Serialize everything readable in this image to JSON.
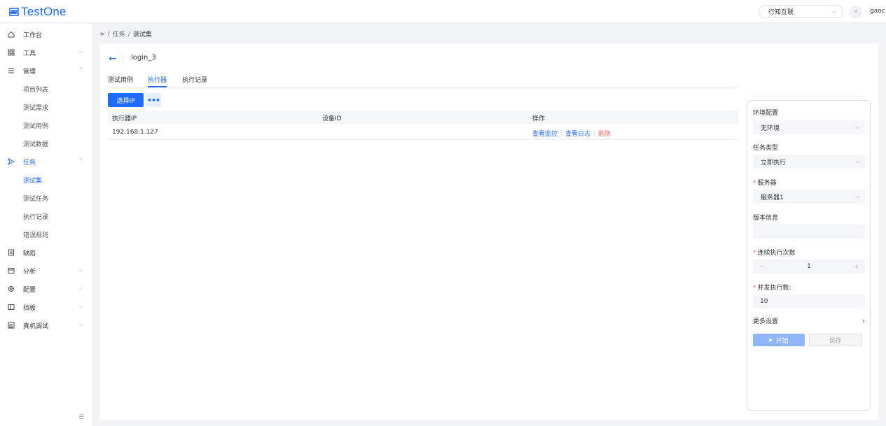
{
  "app": {
    "name": "TestOne"
  },
  "header": {
    "org": "行知互联",
    "lang_icon": "translate-icon",
    "user": "gaoc"
  },
  "sidebar": {
    "items": [
      {
        "label": "工作台",
        "icon": "home-icon"
      },
      {
        "label": "工具",
        "icon": "grid-icon"
      },
      {
        "label": "管理",
        "icon": "list-icon"
      },
      {
        "label": "项目列表"
      },
      {
        "label": "测试需求"
      },
      {
        "label": "测试用例"
      },
      {
        "label": "测试数据"
      },
      {
        "label": "任务",
        "icon": "send-icon"
      },
      {
        "label": "测试集"
      },
      {
        "label": "测试任务"
      },
      {
        "label": "执行记录"
      },
      {
        "label": "错误规则"
      },
      {
        "label": "缺陷",
        "icon": "file-icon"
      },
      {
        "label": "分析",
        "icon": "calendar-icon"
      },
      {
        "label": "配置",
        "icon": "settings-icon"
      },
      {
        "label": "挡板",
        "icon": "panel-icon"
      },
      {
        "label": "真机调试",
        "icon": "device-icon"
      }
    ]
  },
  "breadcrumb": {
    "parent": "任务",
    "current": "测试集",
    "sep": "/"
  },
  "page": {
    "title": "login_3",
    "tabs": [
      "测试用例",
      "执行器",
      "执行记录"
    ],
    "active_tab": "执行器",
    "select_ip_label": "选择IP",
    "more_label": "•••"
  },
  "table": {
    "headers": [
      "执行器IP",
      "设备ID",
      "操作"
    ],
    "rows": [
      {
        "ip": "192.168.1.127",
        "device_id": "",
        "actions": [
          "查看监控",
          "查看日志",
          "删除"
        ]
      }
    ]
  },
  "panel": {
    "env_label": "环境配置",
    "env_value": "无环境",
    "task_type_label": "任务类型",
    "task_type_value": "立即执行",
    "server_label": "服务器",
    "server_value": "服务器1",
    "version_label": "版本信息",
    "version_value": "",
    "repeat_label": "连续执行次数",
    "repeat_value": "1",
    "minus": "−",
    "plus": "+",
    "concurrency_label": "并发执行数:",
    "concurrency_value": "10",
    "more_settings": "更多设置",
    "start_label": "开始",
    "save_label": "保存"
  },
  "colors": {
    "primary": "#1f6bff",
    "danger": "#f56c6c",
    "disabled_primary": "#8fb5fb"
  }
}
